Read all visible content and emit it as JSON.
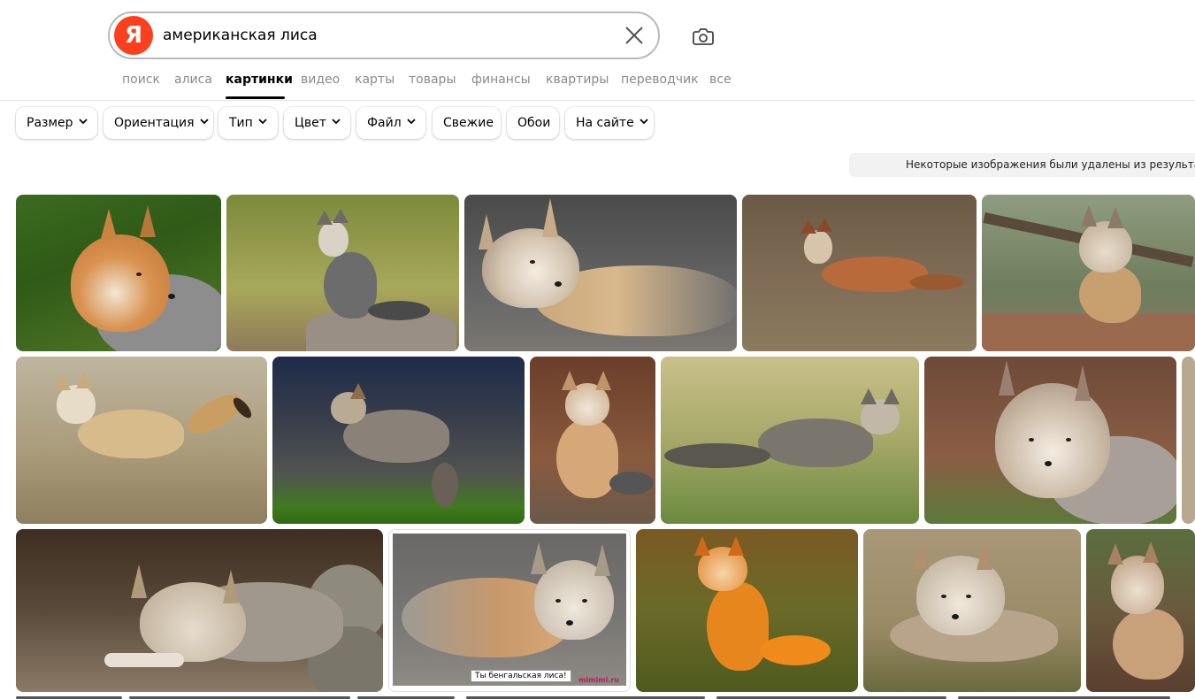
{
  "search": {
    "logo_letter": "Я",
    "query": "американская лиса"
  },
  "tabs": [
    {
      "label": "поиск"
    },
    {
      "label": "алиса"
    },
    {
      "label": "картинки",
      "active": true
    },
    {
      "label": "видео"
    },
    {
      "label": "карты"
    },
    {
      "label": "товары"
    },
    {
      "label": "финансы"
    },
    {
      "label": "квартиры"
    },
    {
      "label": "переводчик"
    },
    {
      "label": "все"
    }
  ],
  "filters": [
    {
      "label": "Размер",
      "dropdown": true
    },
    {
      "label": "Ориентация",
      "dropdown": true
    },
    {
      "label": "Тип",
      "dropdown": true
    },
    {
      "label": "Цвет",
      "dropdown": true
    },
    {
      "label": "Файл",
      "dropdown": true
    },
    {
      "label": "Свежие",
      "dropdown": false
    },
    {
      "label": "Обои",
      "dropdown": false
    },
    {
      "label": "На сайте",
      "dropdown": true
    }
  ],
  "notice": "Некоторые изображения были удалены из результато",
  "images": {
    "caption_text": "Ты бенгальская лиса!",
    "watermark_text": "mimimi.ru"
  },
  "colors": {
    "brand": "#fc3f1d",
    "active_tab": "#000000",
    "inactive_tab": "#8a8a8a"
  }
}
